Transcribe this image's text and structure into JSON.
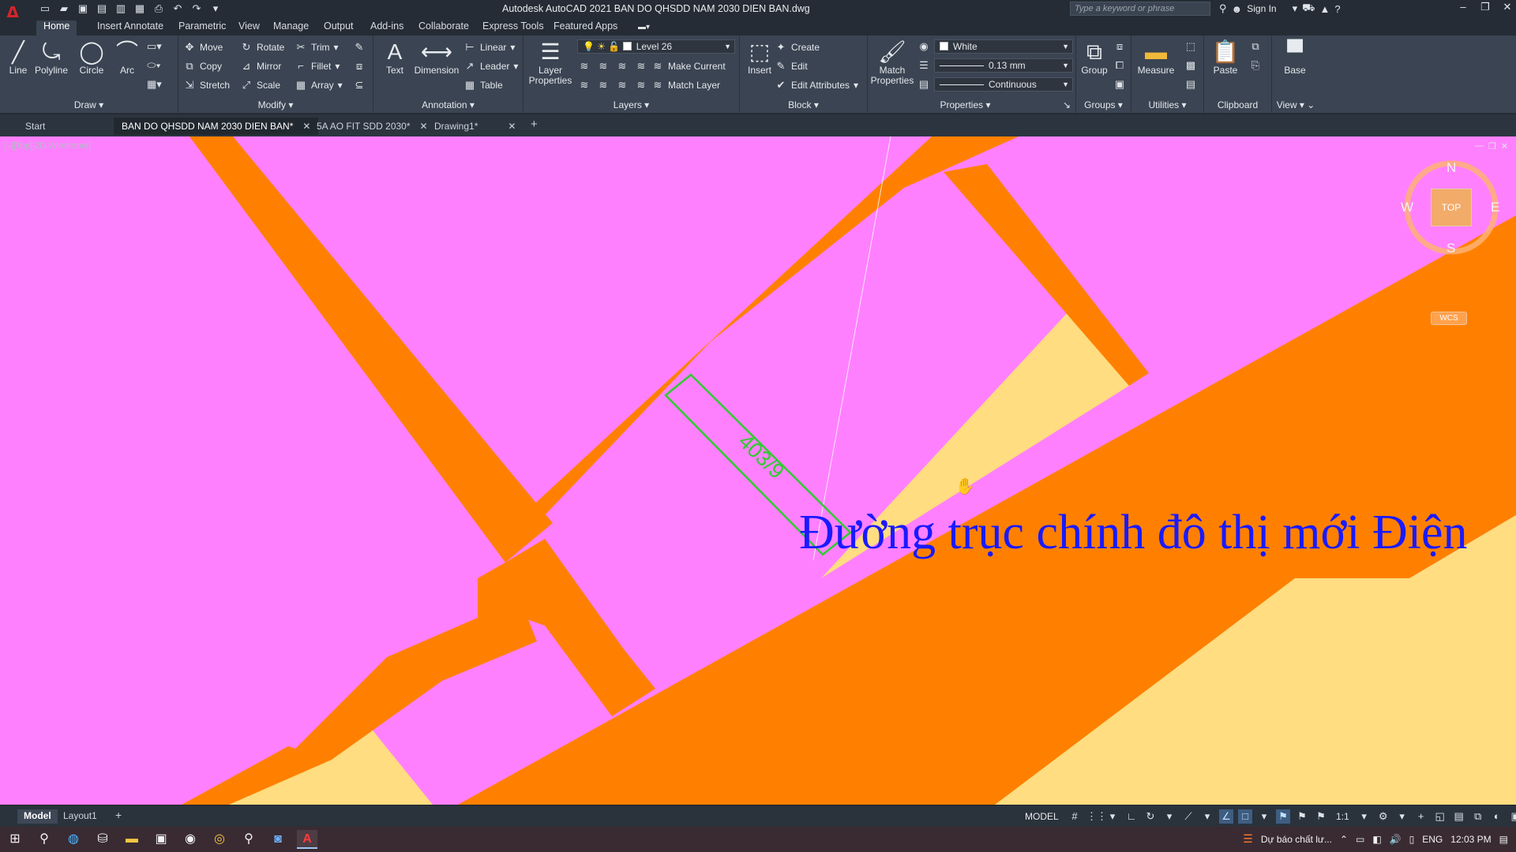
{
  "titlebar": {
    "app_letter": "A",
    "title": "Autodesk AutoCAD 2021    BAN DO QHSDD NAM 2030 DIEN BAN.dwg",
    "search_placeholder": "Type a keyword or phrase",
    "sign_in": "Sign In"
  },
  "ribbon_tabs": [
    "Home",
    "Insert",
    "Annotate",
    "Parametric",
    "View",
    "Manage",
    "Output",
    "Add-ins",
    "Collaborate",
    "Express Tools",
    "Featured Apps"
  ],
  "ribbon": {
    "draw": {
      "title": "Draw",
      "line": "Line",
      "polyline": "Polyline",
      "circle": "Circle",
      "arc": "Arc"
    },
    "modify": {
      "title": "Modify",
      "move": "Move",
      "rotate": "Rotate",
      "trim": "Trim",
      "copy": "Copy",
      "mirror": "Mirror",
      "fillet": "Fillet",
      "stretch": "Stretch",
      "scale": "Scale",
      "array": "Array"
    },
    "annotation": {
      "title": "Annotation",
      "text": "Text",
      "dimension": "Dimension",
      "linear": "Linear",
      "leader": "Leader",
      "table": "Table"
    },
    "layers": {
      "title": "Layers",
      "layer_properties_1": "Layer",
      "layer_properties_2": "Properties",
      "current_layer": "Level 26",
      "make_current": "Make Current",
      "match_layer": "Match Layer"
    },
    "block": {
      "title": "Block",
      "insert": "Insert",
      "create": "Create",
      "edit": "Edit",
      "edit_attributes": "Edit Attributes"
    },
    "properties": {
      "title": "Properties",
      "match_1": "Match",
      "match_2": "Properties",
      "color": "White",
      "lineweight": "0.13 mm",
      "linetype": "Continuous"
    },
    "groups": {
      "title": "Groups",
      "group": "Group"
    },
    "utilities": {
      "title": "Utilities",
      "measure": "Measure"
    },
    "clipboard": {
      "title": "Clipboard",
      "paste": "Paste"
    },
    "view": {
      "title": "View",
      "base": "Base"
    }
  },
  "file_tabs": [
    {
      "label": "Start"
    },
    {
      "label": "BAN DO QHSDD NAM 2030 DIEN BAN*"
    },
    {
      "label": "5A AO FIT SDD 2030*"
    },
    {
      "label": "Drawing1*"
    }
  ],
  "viewport": {
    "label": "[–][Top][2D Wireframe]",
    "parcel_label": "403/9",
    "street_name": "Đường trục chính đô thị mới Điện",
    "colors": {
      "residential": "#ff80ff",
      "road": "#ff8000",
      "green_space": "#ffdd80",
      "parcel_outline": "#2ecc2e",
      "street_text": "#1a1aff"
    }
  },
  "viewcube": {
    "n": "N",
    "s": "S",
    "e": "E",
    "w": "W",
    "top": "TOP",
    "wcs": "WCS"
  },
  "layout_tabs": [
    "Model",
    "Layout1"
  ],
  "statusbar": {
    "model": "MODEL",
    "scale": "1:1"
  },
  "taskbar": {
    "weather": "Dự báo chất lư...",
    "lang": "ENG",
    "time": "12:03 PM"
  }
}
